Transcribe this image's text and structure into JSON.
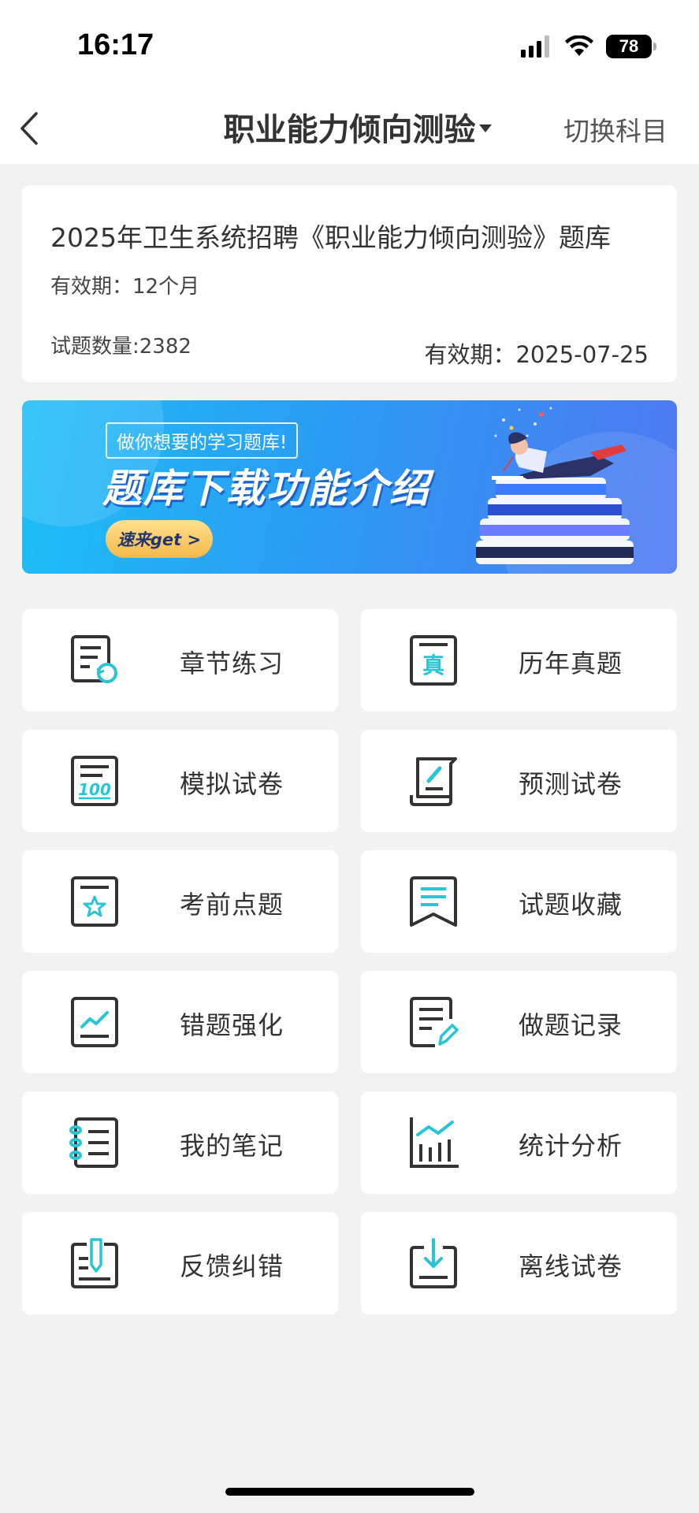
{
  "status_bar": {
    "time": "16:17",
    "battery": "78"
  },
  "nav": {
    "title": "职业能力倾向测验",
    "switch_label": "切换科目"
  },
  "card": {
    "title": "2025年卫生系统招聘《职业能力倾向测验》题库",
    "validity_duration": "有效期：12个月",
    "question_count": "试题数量:2382",
    "valid_until": "有效期：2025-07-25"
  },
  "banner": {
    "tag": "做你想要的学习题库!",
    "headline": "题库下载功能介绍",
    "button": "速来get >"
  },
  "features": [
    {
      "label": "章节练习",
      "icon": "chapter-practice-icon"
    },
    {
      "label": "历年真题",
      "icon": "past-exams-icon"
    },
    {
      "label": "模拟试卷",
      "icon": "mock-paper-icon"
    },
    {
      "label": "预测试卷",
      "icon": "predict-paper-icon"
    },
    {
      "label": "考前点题",
      "icon": "pre-exam-tips-icon"
    },
    {
      "label": "试题收藏",
      "icon": "favorites-icon"
    },
    {
      "label": "错题强化",
      "icon": "wrong-questions-icon"
    },
    {
      "label": "做题记录",
      "icon": "practice-record-icon"
    },
    {
      "label": "我的笔记",
      "icon": "notes-icon"
    },
    {
      "label": "统计分析",
      "icon": "statistics-icon"
    },
    {
      "label": "反馈纠错",
      "icon": "feedback-icon"
    },
    {
      "label": "离线试卷",
      "icon": "offline-download-icon"
    }
  ],
  "colors": {
    "accent": "#27c6d6",
    "icon_stroke": "#333333",
    "background": "#f2f2f2"
  }
}
